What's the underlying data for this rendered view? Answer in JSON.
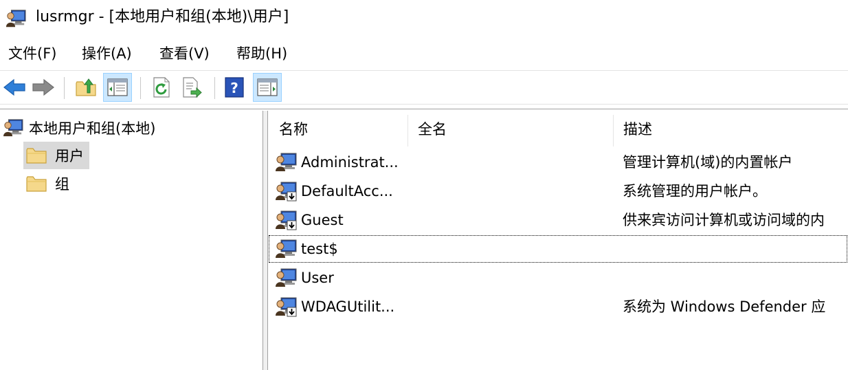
{
  "window": {
    "title": "lusrmgr - [本地用户和组(本地)\\用户]"
  },
  "menu": {
    "file": "文件(F)",
    "action": "操作(A)",
    "view": "查看(V)",
    "help": "帮助(H)"
  },
  "toolbar": {
    "icons": [
      "back-arrow-icon",
      "forward-arrow-icon",
      "up-folder-icon",
      "show-hide-console-tree-icon",
      "refresh-icon",
      "export-list-icon",
      "help-icon",
      "show-hide-action-pane-icon"
    ],
    "pressed": [
      "show-hide-console-tree-icon",
      "show-hide-action-pane-icon"
    ]
  },
  "tree": {
    "root": "本地用户和组(本地)",
    "items": [
      {
        "label": "用户",
        "selected": true
      },
      {
        "label": "组",
        "selected": false
      }
    ]
  },
  "list": {
    "columns": {
      "name": "名称",
      "fullname": "全名",
      "description": "描述"
    },
    "rows": [
      {
        "name": "Administrat...",
        "fullname": "",
        "description": "管理计算机(域)的内置帐户",
        "disabled": false
      },
      {
        "name": "DefaultAcc...",
        "fullname": "",
        "description": "系统管理的用户帐户。",
        "disabled": true
      },
      {
        "name": "Guest",
        "fullname": "",
        "description": "供来宾访问计算机或访问域的内",
        "disabled": true
      },
      {
        "name": "test$",
        "fullname": "",
        "description": "",
        "disabled": false
      },
      {
        "name": "User",
        "fullname": "",
        "description": "",
        "disabled": false
      },
      {
        "name": "WDAGUtilit...",
        "fullname": "",
        "description": "系统为 Windows Defender 应",
        "disabled": true
      }
    ]
  },
  "colors": {
    "selection": "#d9d9d9",
    "pressed_button": "#cce8ff",
    "folder": "#f5d88b",
    "back_arrow": "#2f7fd8"
  }
}
